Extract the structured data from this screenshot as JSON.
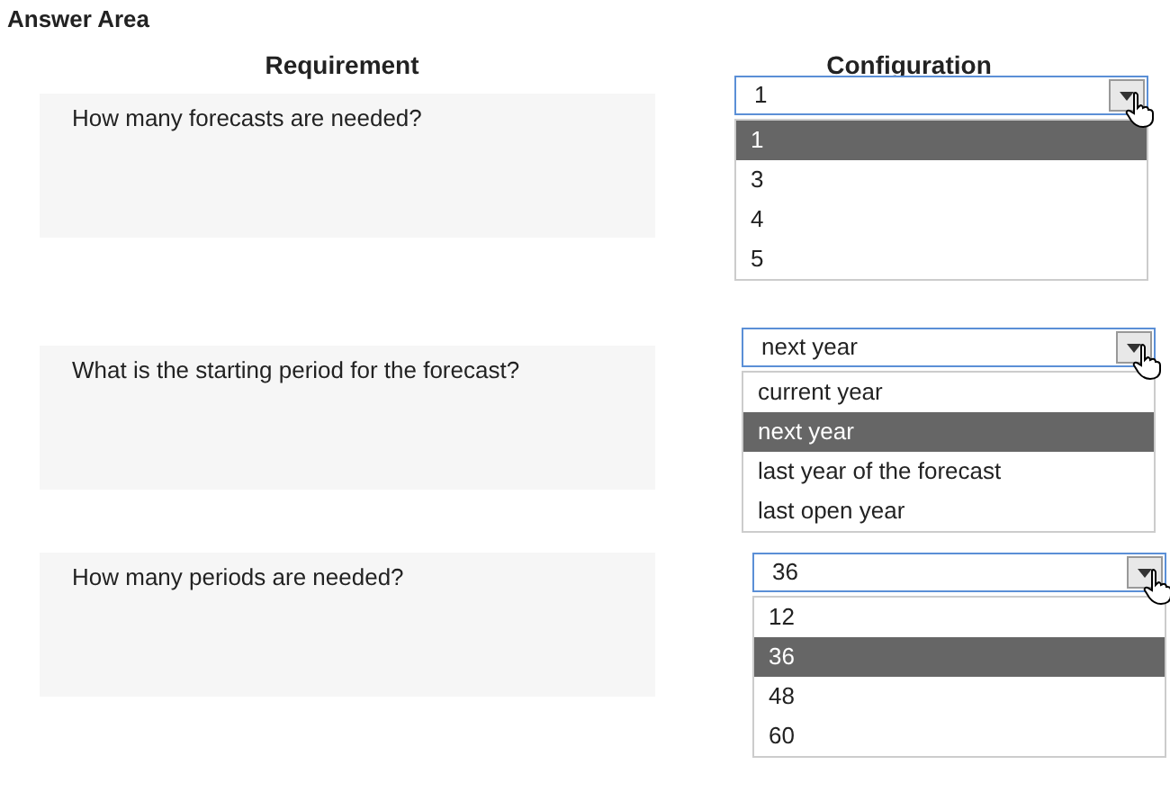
{
  "title": "Answer Area",
  "headers": [
    "Requirement",
    "Configuration"
  ],
  "questions": [
    {
      "text": "How many forecasts are needed?",
      "dropdown": {
        "value": "1",
        "options": [
          {
            "label": "1",
            "selected": true
          },
          {
            "label": "3",
            "selected": false
          },
          {
            "label": "4",
            "selected": false
          },
          {
            "label": "5",
            "selected": false
          }
        ]
      }
    },
    {
      "text": "What is the starting period for the forecast?",
      "dropdown": {
        "value": "next year",
        "options": [
          {
            "label": "current year",
            "selected": false
          },
          {
            "label": "next year",
            "selected": true
          },
          {
            "label": "last year of the forecast",
            "selected": false
          },
          {
            "label": "last open year",
            "selected": false
          }
        ]
      }
    },
    {
      "text": "How many periods are needed?",
      "dropdown": {
        "value": "36",
        "options": [
          {
            "label": "12",
            "selected": false
          },
          {
            "label": "36",
            "selected": true
          },
          {
            "label": "48",
            "selected": false
          },
          {
            "label": "60",
            "selected": false
          }
        ]
      }
    }
  ]
}
